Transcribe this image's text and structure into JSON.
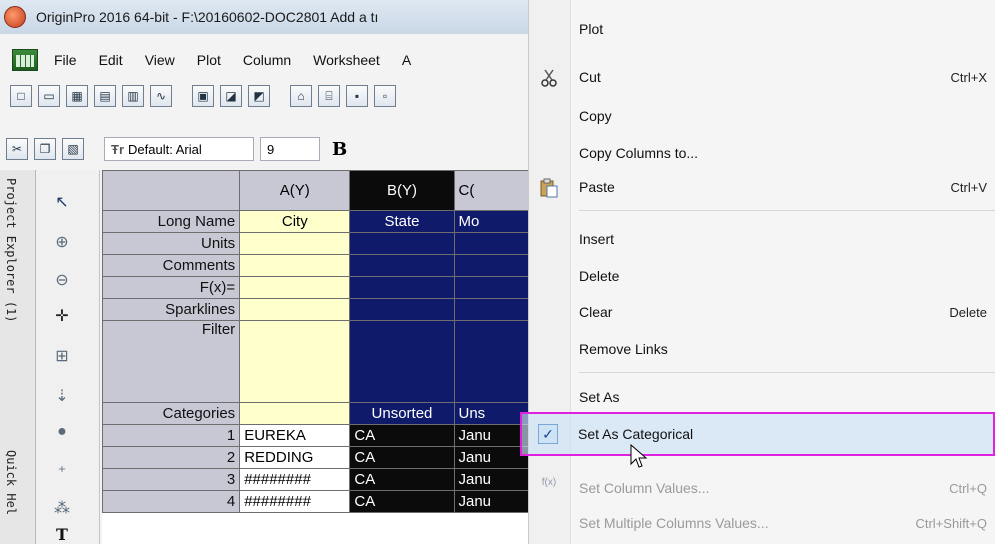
{
  "window": {
    "title": "OriginPro 2016 64-bit - F:\\20160602-DOC2801 Add a tı"
  },
  "menubar": {
    "items": [
      "File",
      "Edit",
      "View",
      "Plot",
      "Column",
      "Worksheet",
      "A"
    ]
  },
  "format_toolbar": {
    "font": "Default: Arial",
    "size": "9",
    "bold_label": "B"
  },
  "side_panels": {
    "project_explorer": "Project Explorer (1)",
    "quick_help": "Quick Hel"
  },
  "worksheet": {
    "columns": [
      "A(Y)",
      "B(Y)",
      "C("
    ],
    "row_labels": [
      "Long Name",
      "Units",
      "Comments",
      "F(x)=",
      "Sparklines",
      "Filter",
      "Categories"
    ],
    "long_names": [
      "City",
      "State",
      "Mo"
    ],
    "categories": [
      "",
      "Unsorted",
      "Uns"
    ],
    "rows": [
      {
        "n": "1",
        "a": "EUREKA",
        "b": "CA",
        "c": "Janu"
      },
      {
        "n": "2",
        "a": "REDDING",
        "b": "CA",
        "c": "Janu"
      },
      {
        "n": "3",
        "a": "########",
        "b": "CA",
        "c": "Janu"
      },
      {
        "n": "4",
        "a": "########",
        "b": "CA",
        "c": "Janu"
      }
    ]
  },
  "context_menu": {
    "plot": "Plot",
    "cut": "Cut",
    "cut_shortcut": "Ctrl+X",
    "copy": "Copy",
    "copy_columns_to": "Copy Columns to...",
    "paste": "Paste",
    "paste_shortcut": "Ctrl+V",
    "insert": "Insert",
    "delete": "Delete",
    "clear": "Clear",
    "clear_shortcut": "Delete",
    "remove_links": "Remove Links",
    "set_as": "Set As",
    "set_as_categorical": "Set As Categorical",
    "set_column_values": "Set Column Values...",
    "set_column_values_shortcut": "Ctrl+Q",
    "set_multiple_columns_values": "Set Multiple Columns Values...",
    "set_multiple_columns_values_shortcut": "Ctrl+Shift+Q"
  },
  "colors": {
    "highlight_border": "#e020e0",
    "column_selected": "#0f1a6b",
    "column_a": "#ffffcc"
  }
}
